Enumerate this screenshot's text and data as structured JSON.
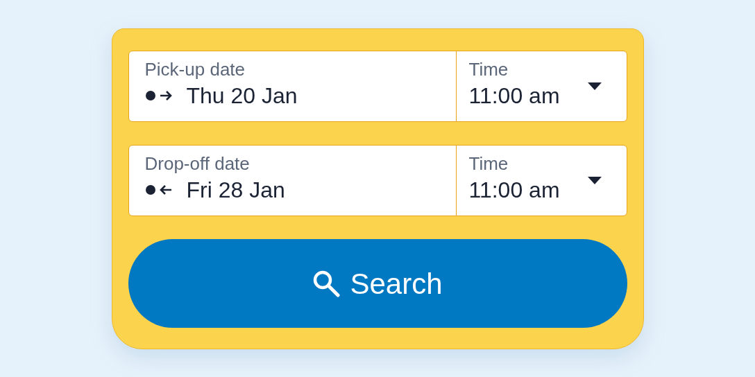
{
  "rows": [
    {
      "kind": "pickup",
      "date_label": "Pick-up date",
      "date": "Thu 20 Jan",
      "time_label": "Time",
      "time": "11:00 am"
    },
    {
      "kind": "dropoff",
      "date_label": "Drop-off date",
      "date": "Fri 28 Jan",
      "time_label": "Time",
      "time": "11:00 am"
    }
  ],
  "search_button": {
    "label": "Search"
  }
}
